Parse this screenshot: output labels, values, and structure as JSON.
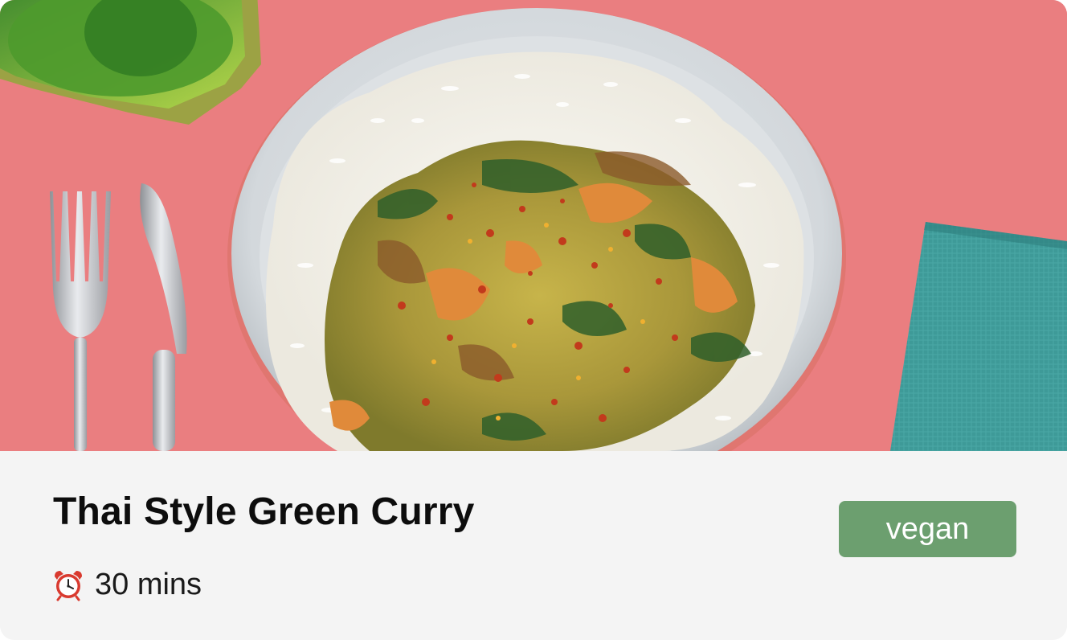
{
  "recipe": {
    "title": "Thai Style Green Curry",
    "duration": "30 mins",
    "tag": "vegan"
  },
  "icons": {
    "duration_icon": "alarm-clock-icon"
  },
  "colors": {
    "tag_background": "#6c9f6f",
    "photo_background": "#ea7a7c",
    "info_background": "#f4f4f4"
  }
}
